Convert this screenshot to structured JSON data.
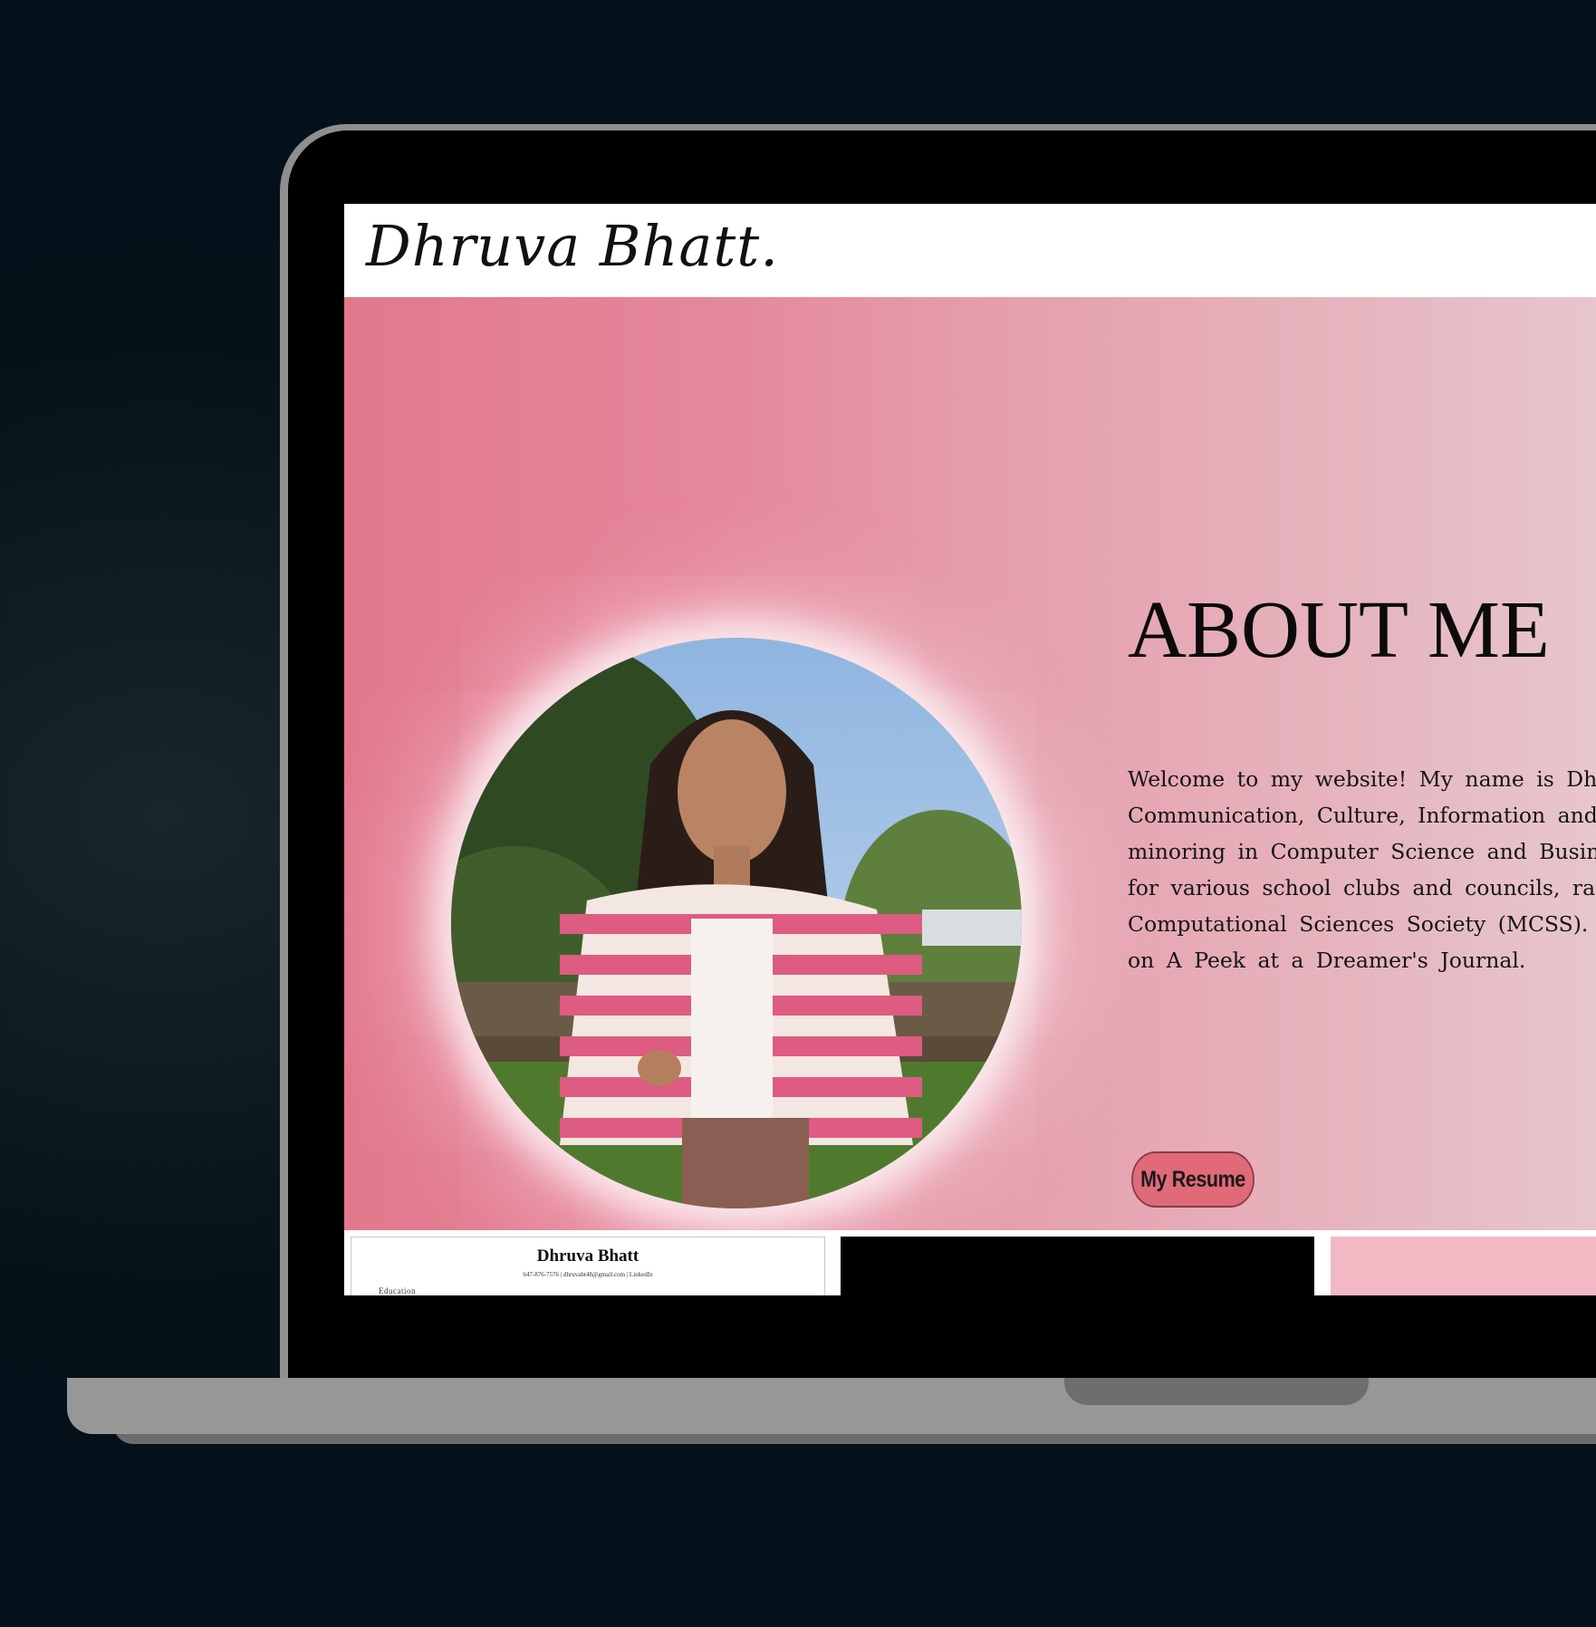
{
  "site": {
    "logo_text": "Dhruva Bhatt."
  },
  "about": {
    "title": "ABOUT ME",
    "lines": [
      "Welcome to my website! My name is Dhru",
      "Communication, Culture, Information and T",
      "minoring in Computer Science and Business F",
      "for various school clubs and councils, ranging",
      "Computational Sciences Society (MCSS). Aside",
      "on A Peek at a Dreamer's Journal."
    ],
    "button_label": "My Resume"
  },
  "cards": {
    "resume_preview": {
      "name": "Dhruva Bhatt",
      "contact": "647-876-7576 | dhruvabt48@gmail.com | LinkedIn",
      "section": "Education"
    }
  },
  "colors": {
    "hero_gradient_start": "#e2798d",
    "hero_gradient_end": "#e7c6cc",
    "button": "#e06a78",
    "pink_card": "#f2b8c4"
  }
}
